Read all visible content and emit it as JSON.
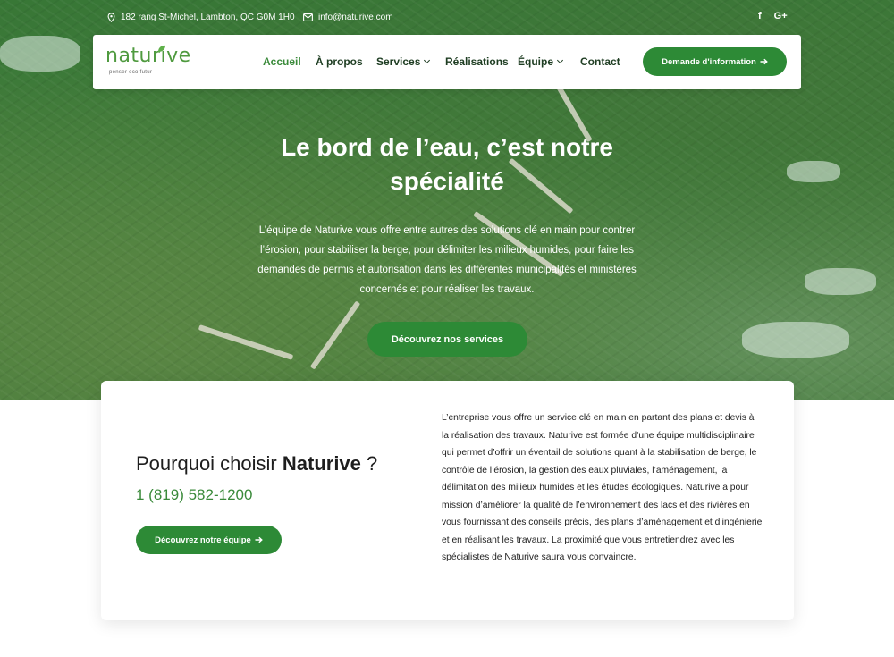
{
  "topbar": {
    "address": "182 rang St-Michel, Lambton, QC G0M 1H0",
    "email": "info@naturive.com",
    "social": [
      "f",
      "G+"
    ]
  },
  "brand": {
    "name": "naturive",
    "tagline": "penser eco futur",
    "color": "#4f9a3f"
  },
  "nav": {
    "items": [
      {
        "label": "Accueil",
        "active": true
      },
      {
        "label": "À propos"
      },
      {
        "label": "Services",
        "dropdown": true
      },
      {
        "label": "Réalisations"
      },
      {
        "label": "Équipe",
        "dropdown": true
      },
      {
        "label": "Contact"
      }
    ],
    "cta": "Demande d'information"
  },
  "hero": {
    "title": "Le bord de l’eau, c’est notre spécialité",
    "text": "L’équipe de Naturive vous offre entre autres des solutions clé en main pour contrer l’érosion, pour stabiliser la berge, pour délimiter les milieux humides, pour faire les demandes de permis et autorisation dans les différentes municipalités et ministères concernés et pour réaliser les travaux.",
    "button": "Découvrez nos services"
  },
  "why": {
    "title_prefix": "Pourquoi choisir ",
    "title_brand": "Naturive",
    "title_suffix": " ?",
    "phone": "1 (819) 582-1200",
    "button": "Découvrez notre équipe",
    "about": "L’entreprise vous offre un service clé en main en partant des plans et devis à la réalisation des travaux. Naturive est formée d’une équipe multidisciplinaire qui permet d’offrir un éventail de solutions quant à la stabilisation de berge, le contrôle de l’érosion, la gestion des eaux pluviales, l’aménagement, la délimitation des milieux humides et les études écologiques. Naturive a pour mission d’améliorer la qualité de l’environnement des lacs et des rivières en vous fournissant des conseils précis, des plans d’aménagement et d’ingénierie et en réalisant les travaux. La proximité que vous entretiendrez avec les spécialistes de Naturive saura vous convaincre."
  },
  "colors": {
    "accent": "#2d8a36",
    "nav_text": "#1e3d22",
    "phone": "#3a8a3a"
  }
}
